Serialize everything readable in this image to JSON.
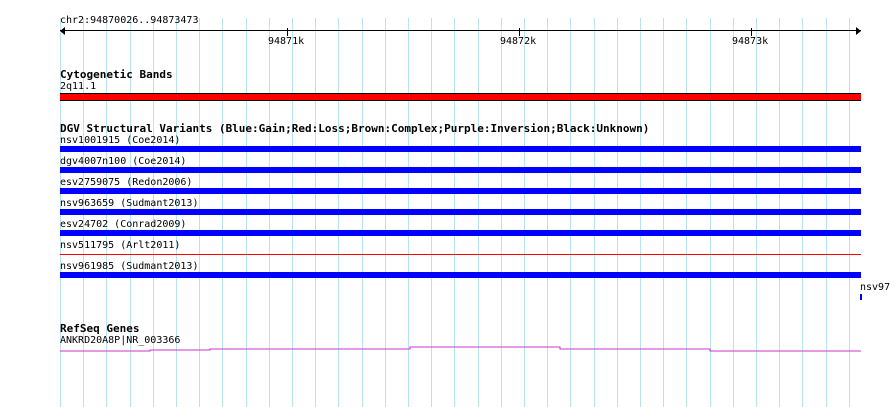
{
  "ruler": {
    "location": "chr2:94870026..94873473",
    "ticks": [
      "94871k",
      "94872k",
      "94873k"
    ]
  },
  "cytoband": {
    "title": "Cytogenetic Bands",
    "band_label": "2q11.1",
    "color": "#ff0000"
  },
  "dgv": {
    "title": "DGV Structural Variants (Blue:Gain;Red:Loss;Brown:Complex;Purple:Inversion;Black:Unknown)",
    "variants": [
      {
        "label": "nsv1001915 (Coe2014)",
        "color": "#0000ff",
        "type": "gain"
      },
      {
        "label": "dgv4007n100 (Coe2014)",
        "color": "#0000ff",
        "type": "gain"
      },
      {
        "label": "esv2759075 (Redon2006)",
        "color": "#0000ff",
        "type": "gain"
      },
      {
        "label": "nsv963659 (Sudmant2013)",
        "color": "#0000ff",
        "type": "gain"
      },
      {
        "label": "esv24702 (Conrad2009)",
        "color": "#0000ff",
        "type": "gain"
      },
      {
        "label": "nsv511795 (Arlt2011)",
        "color": "#ff0000",
        "type": "loss"
      },
      {
        "label": "nsv961985 (Sudmant2013)",
        "color": "#0000ff",
        "type": "gain"
      }
    ],
    "overflow_label": "nsv97"
  },
  "refseq": {
    "title": "RefSeq Genes",
    "gene_label": "ANKRD20A8P|NR_003366",
    "color": "#cc33cc"
  }
}
